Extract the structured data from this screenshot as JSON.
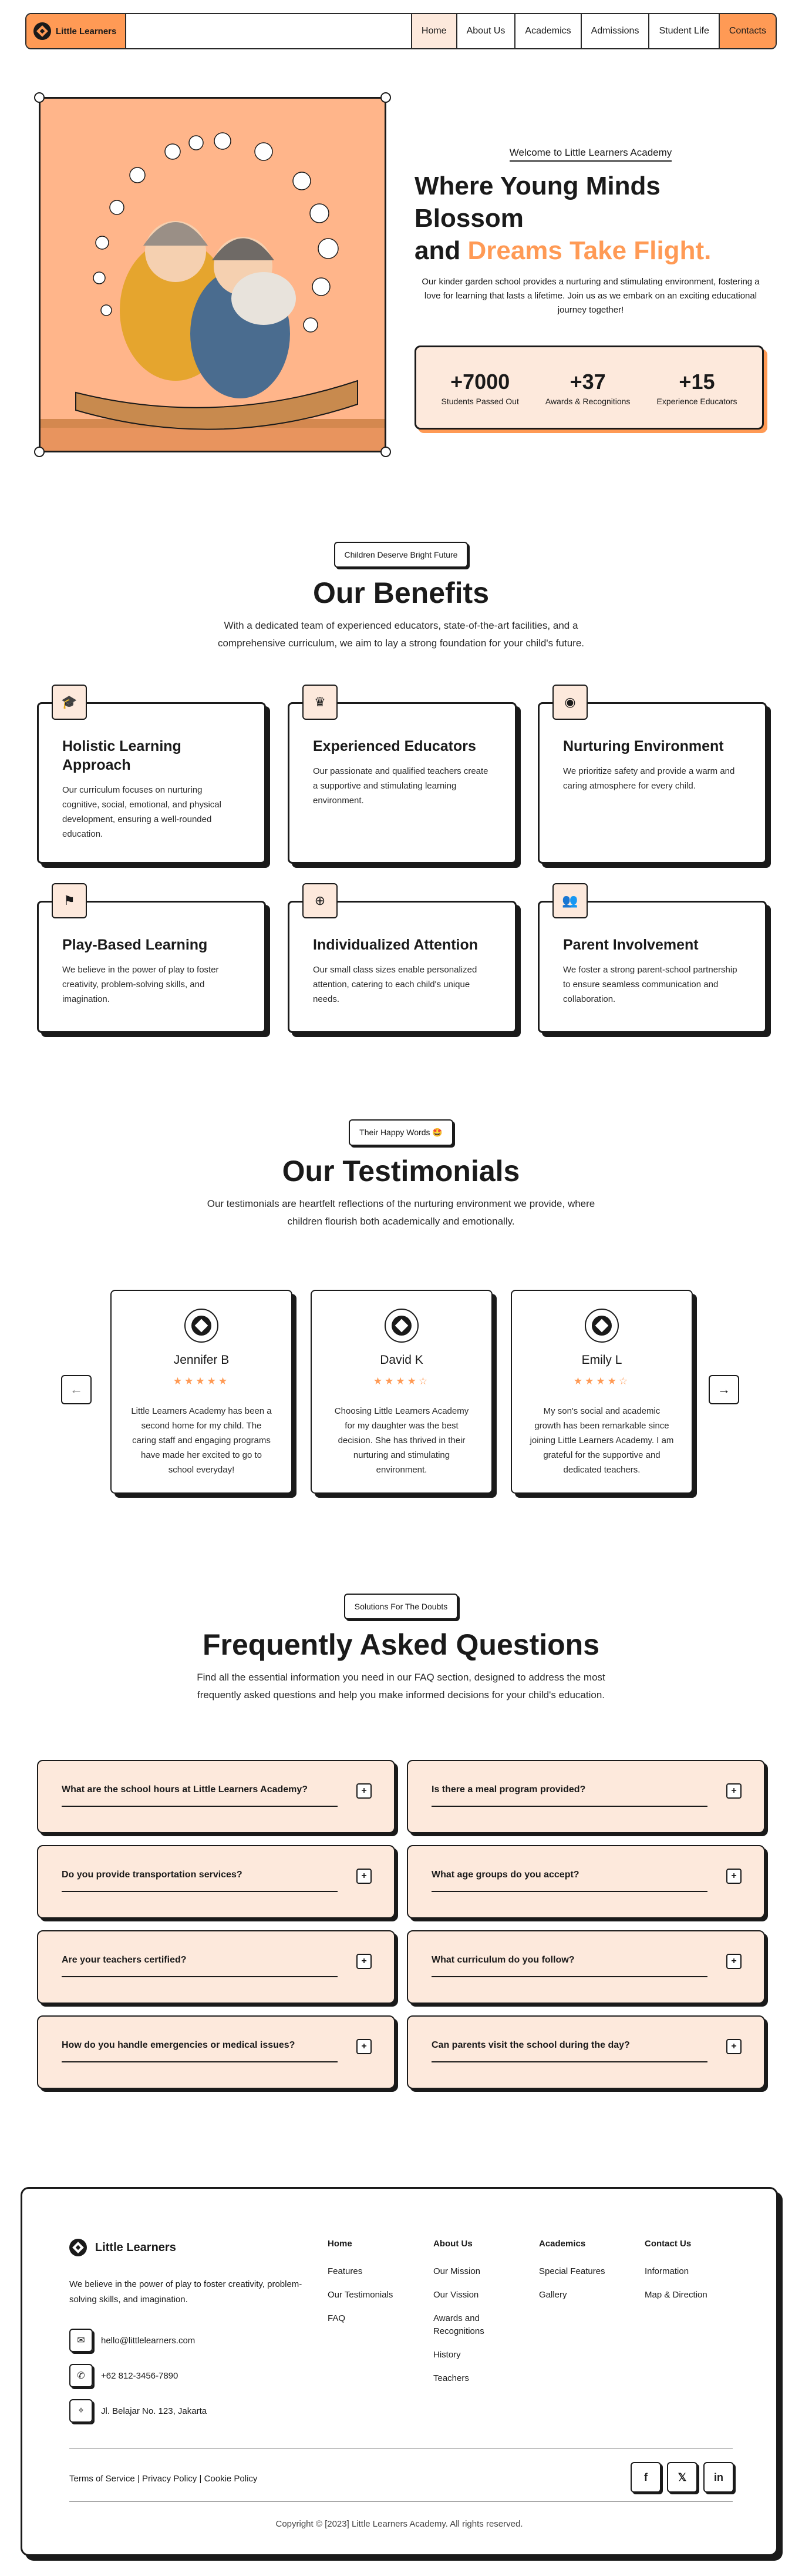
{
  "nav": {
    "logo": "Little Learners",
    "items": [
      "Home",
      "About Us",
      "Academics",
      "Admissions",
      "Student Life",
      "Contacts"
    ]
  },
  "hero": {
    "welcome": "Welcome to Little Learners Academy",
    "title_line1": "Where Young Minds Blossom",
    "title_and": "and ",
    "title_accent": "Dreams Take Flight.",
    "description": "Our kinder garden school provides a nurturing and stimulating environment, fostering a love for learning that lasts a lifetime. Join us as we embark on an exciting educational journey together!",
    "stats": [
      {
        "value": "+7000",
        "label": "Students Passed Out"
      },
      {
        "value": "+37",
        "label": "Awards & Recognitions"
      },
      {
        "value": "+15",
        "label": "Experience Educators"
      }
    ]
  },
  "benefits": {
    "tag": "Children Deserve Bright Future",
    "title": "Our Benefits",
    "description": "With a dedicated team of experienced educators, state-of-the-art facilities, and a comprehensive curriculum, we aim to lay a strong foundation for your child's future.",
    "items": [
      {
        "title": "Holistic Learning Approach",
        "text": "Our curriculum focuses on nurturing cognitive, social, emotional, and physical development, ensuring a well-rounded education.",
        "icon": "graduation-cap-icon"
      },
      {
        "title": "Experienced Educators",
        "text": "Our passionate and qualified teachers create a supportive and stimulating learning environment.",
        "icon": "crown-icon"
      },
      {
        "title": "Nurturing Environment",
        "text": "We prioritize safety and provide a warm and caring atmosphere for every child.",
        "icon": "eye-icon"
      },
      {
        "title": "Play-Based Learning",
        "text": "We believe in the power of play to foster creativity, problem-solving skills, and imagination.",
        "icon": "flag-icon"
      },
      {
        "title": "Individualized Attention",
        "text": "Our small class sizes enable personalized attention, catering to each child's unique needs.",
        "icon": "globe-icon"
      },
      {
        "title": "Parent Involvement",
        "text": "We foster a strong parent-school partnership to ensure seamless communication and collaboration.",
        "icon": "users-icon"
      }
    ]
  },
  "testimonials": {
    "tag": "Their Happy Words 🤩",
    "title": "Our Testimonials",
    "description": "Our testimonials are heartfelt reflections of the nurturing environment we provide, where children flourish both academically and emotionally.",
    "items": [
      {
        "name": "Jennifer B",
        "stars": "★★★★★",
        "text": "Little Learners Academy has been a second home for my child. The caring staff and engaging programs have made her excited to go to school everyday!"
      },
      {
        "name": "David K",
        "stars": "★★★★☆",
        "text": "Choosing Little Learners Academy for my daughter was the best decision. She has thrived in their nurturing and stimulating environment."
      },
      {
        "name": "Emily L",
        "stars": "★★★★☆",
        "text": "My son's social and academic growth has been remarkable since joining Little Learners Academy. I am grateful for the supportive and dedicated teachers."
      }
    ],
    "prev": "←",
    "next": "→"
  },
  "faq": {
    "tag": "Solutions For The Doubts",
    "title": "Frequently Asked Questions",
    "description": "Find all the essential information you need in our FAQ section, designed to address the most frequently asked questions and help you make informed decisions for your child's education.",
    "items": [
      "What are the school hours at Little Learners Academy?",
      "Is there a meal program provided?",
      "Do you provide transportation services?",
      "What age groups do you accept?",
      "Are your teachers certified?",
      "What curriculum do you follow?",
      "How do you handle emergencies or medical issues?",
      "Can parents visit the school during the day?"
    ],
    "toggle": "+"
  },
  "footer": {
    "brand": "Little Learners",
    "description": "We believe in the power of play to foster creativity, problem-solving skills, and imagination.",
    "email": "hello@littlelearners.com",
    "phone": "+62 812-3456-7890",
    "address": "Jl. Belajar No. 123, Jakarta",
    "columns": [
      {
        "heading": "Home",
        "links": [
          "Features",
          "Our Testimonials",
          "FAQ"
        ]
      },
      {
        "heading": "About Us",
        "links": [
          "Our Mission",
          "Our Vission",
          "Awards and Recognitions",
          "History",
          "Teachers"
        ]
      },
      {
        "heading": "Academics",
        "links": [
          "Special Features",
          "Gallery"
        ]
      },
      {
        "heading": "Contact Us",
        "links": [
          "Information",
          "Map & Direction"
        ]
      }
    ],
    "legal": [
      "Terms of Service",
      "Privacy Policy",
      "Cookie Policy"
    ],
    "legal_sep": "|",
    "social": [
      "facebook-icon",
      "twitter-icon",
      "linkedin-icon"
    ],
    "copyright": "Copyright © [2023] Little Learners Academy. All rights reserved."
  },
  "colors": {
    "accent": "#ff9a55",
    "accent_light": "#fde9dc",
    "ink": "#1a1a1a"
  }
}
